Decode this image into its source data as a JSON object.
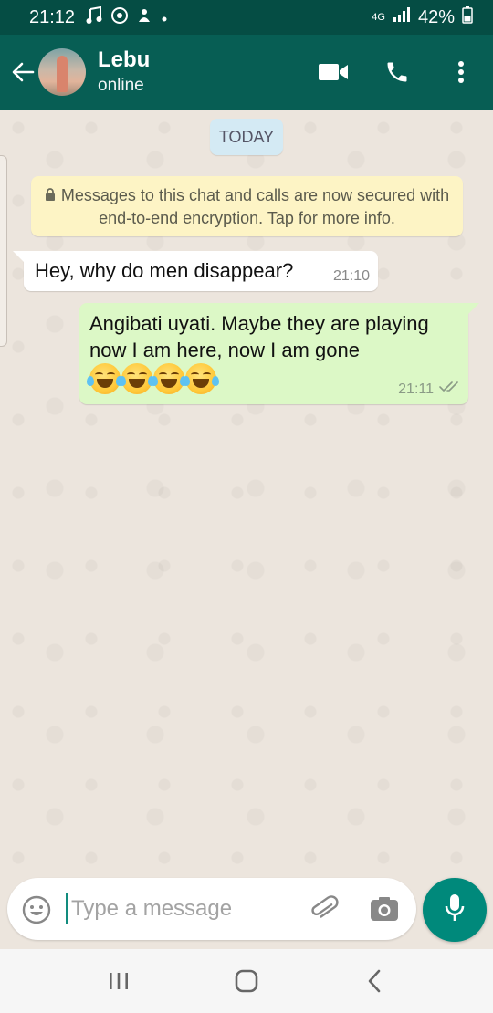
{
  "status_bar": {
    "time": "21:12",
    "network": "4G",
    "battery": "42%",
    "icons": [
      "music-note-icon",
      "chrome-icon",
      "notification-icon",
      "dot-icon",
      "signal-icon",
      "battery-icon"
    ]
  },
  "header": {
    "contact_name": "Lebu",
    "status": "online",
    "back_icon": "arrow-left-icon",
    "actions": [
      "video-call-icon",
      "voice-call-icon",
      "more-vert-icon"
    ]
  },
  "chat": {
    "date_chip": "TODAY",
    "encryption_notice": "Messages to this chat and calls are now secured with end-to-end encryption. Tap for more info.",
    "messages": [
      {
        "direction": "incoming",
        "text": "Hey, why do men disappear?",
        "time": "21:10"
      },
      {
        "direction": "outgoing",
        "text": "Angibati uyati. Maybe they are playing now I am here, now I am gone",
        "emojis": "😂😂😂😂",
        "time": "21:11",
        "status": "read-double-check"
      }
    ]
  },
  "composer": {
    "placeholder": "Type a message",
    "value": "",
    "icons": [
      "emoji-icon",
      "attach-icon",
      "camera-icon",
      "mic-icon"
    ]
  },
  "nav_bar": {
    "icons": [
      "recent-apps-icon",
      "home-icon",
      "back-icon"
    ]
  },
  "colors": {
    "header": "#075e54",
    "status_bar": "#054d44",
    "outgoing_bubble": "#dcf8c6",
    "incoming_bubble": "#ffffff",
    "mic_button": "#00897b",
    "encryption_notice": "#fdf4c5",
    "date_chip": "#d4eaf4"
  }
}
